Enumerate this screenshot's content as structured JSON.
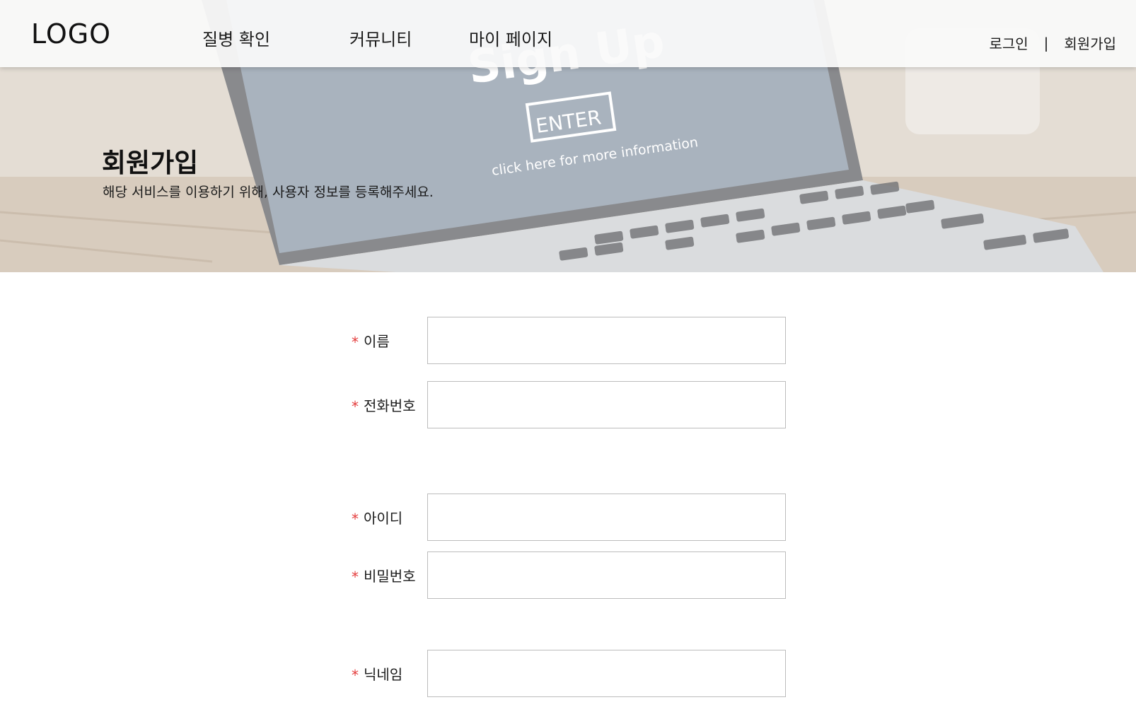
{
  "header": {
    "logo": "LOGO",
    "nav": [
      {
        "label": "질병 확인"
      },
      {
        "label": "커뮤니티"
      },
      {
        "label": "마이 페이지"
      }
    ],
    "auth": {
      "login": "로그인",
      "separator": "|",
      "signup": "회원가입"
    }
  },
  "hero": {
    "title": "회원가입",
    "subtitle": "해당 서비스를 이용하기 위해, 사용자 정보를 등록해주세요.",
    "image_text": {
      "headline": "Sign Up",
      "button": "ENTER",
      "caption": "click here for more information"
    }
  },
  "form": {
    "required_mark": "*",
    "fields": [
      {
        "label": "이름",
        "value": "",
        "placeholder": ""
      },
      {
        "label": "전화번호",
        "value": "",
        "placeholder": ""
      },
      {
        "label": "아이디",
        "value": "",
        "placeholder": ""
      },
      {
        "label": "비밀번호",
        "value": "",
        "placeholder": ""
      },
      {
        "label": "닉네임",
        "value": "",
        "placeholder": ""
      }
    ]
  },
  "colors": {
    "required": "#e43b3b",
    "input_border": "#bcbcbc",
    "header_bg": "#fafafa"
  }
}
